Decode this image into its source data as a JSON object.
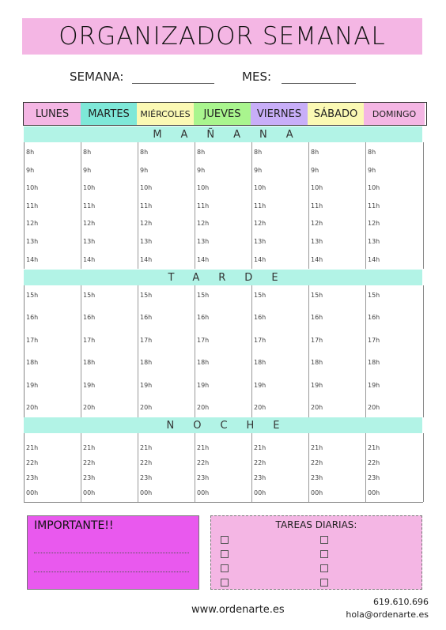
{
  "title": "ORGANIZADOR SEMANAL",
  "semana_label": "SEMANA:",
  "mes_label": "MES:",
  "days": [
    {
      "label": "LUNES",
      "color": "#f4b6e4"
    },
    {
      "label": "MARTES",
      "color": "#7ee8d8"
    },
    {
      "label": "MIÉRCOLES",
      "color": "#fbf9b4"
    },
    {
      "label": "JUEVES",
      "color": "#a9f58e"
    },
    {
      "label": "VIERNES",
      "color": "#c8aef8"
    },
    {
      "label": "SÁBADO",
      "color": "#fbf9b4"
    },
    {
      "label": "DOMINGO",
      "color": "#f4b6e4"
    }
  ],
  "sections": {
    "manana": "MAÑANA",
    "tarde": "TARDE",
    "noche": "NOCHE"
  },
  "hours": {
    "manana": [
      "8h",
      "9h",
      "10h",
      "11h",
      "12h",
      "13h",
      "14h"
    ],
    "tarde": [
      "15h",
      "16h",
      "17h",
      "18h",
      "19h",
      "20h"
    ],
    "noche": [
      "21h",
      "22h",
      "23h",
      "00h"
    ]
  },
  "importante_label": "IMPORTANTE!!",
  "tareas_label": "TAREAS DIARIAS:",
  "website": "www.ordenarte.es",
  "phone": "619.610.696",
  "email": "hola@ordenarte.es",
  "colors": {
    "pink": "#f4b6e4",
    "mint": "#b2f3e6",
    "magenta": "#e959ee"
  }
}
